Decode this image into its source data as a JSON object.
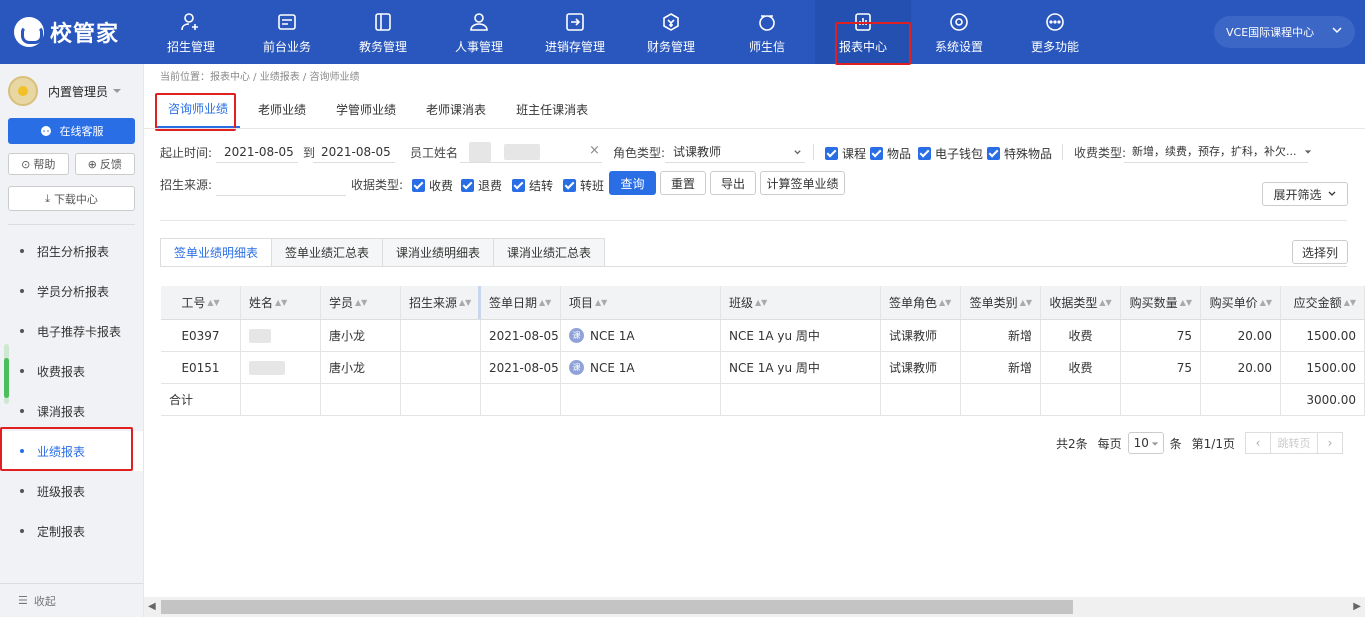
{
  "app": {
    "logo": "校管家",
    "org": "VCE国际课程中心"
  },
  "nav": [
    {
      "label": "招生管理",
      "icon": "user-add-icon"
    },
    {
      "label": "前台业务",
      "icon": "card-icon"
    },
    {
      "label": "教务管理",
      "icon": "book-icon"
    },
    {
      "label": "人事管理",
      "icon": "person-icon"
    },
    {
      "label": "进销存管理",
      "icon": "import-icon"
    },
    {
      "label": "财务管理",
      "icon": "money-icon"
    },
    {
      "label": "师生信",
      "icon": "chat-icon"
    },
    {
      "label": "报表中心",
      "icon": "report-icon"
    },
    {
      "label": "系统设置",
      "icon": "settings-icon"
    },
    {
      "label": "更多功能",
      "icon": "more-icon"
    }
  ],
  "sidebar": {
    "user": "内置管理员",
    "service": "在线客服",
    "help": "帮助",
    "feedback": "反馈",
    "download": "下载中心",
    "items": [
      "招生分析报表",
      "学员分析报表",
      "电子推荐卡报表",
      "收费报表",
      "课消报表",
      "业绩报表",
      "班级报表",
      "定制报表"
    ],
    "collapse": "收起"
  },
  "breadcrumb": "当前位置：报表中心 / 业绩报表 / 咨询师业绩",
  "tabs": [
    "咨询师业绩",
    "老师业绩",
    "学管师业绩",
    "老师课消表",
    "班主任课消表"
  ],
  "filters": {
    "date_label": "起止时间:",
    "date_from": "2021-08-05",
    "to_label": "到",
    "date_to": "2021-08-05",
    "staff_label": "员工姓名",
    "clear": "×",
    "role_label": "角色类型:",
    "role_value": "试课教师",
    "item_checks": [
      "课程",
      "物品",
      "电子钱包",
      "特殊物品"
    ],
    "fee_label": "收费类型:",
    "fee_value": "新增，续费，预存，扩科，补欠...",
    "source_label": "招生来源:",
    "receipt_label": "收据类型:",
    "receipt_checks": [
      "收费",
      "退费",
      "结转",
      "转班"
    ],
    "query": "查询",
    "reset": "重置",
    "export": "导出",
    "calc": "计算签单业绩",
    "expand": "展开筛选"
  },
  "subtabs": [
    "签单业绩明细表",
    "签单业绩汇总表",
    "课消业绩明细表",
    "课消业绩汇总表"
  ],
  "select_cols": "选择列",
  "table": {
    "headers": [
      "工号",
      "姓名",
      "学员",
      "招生来源",
      "签单日期",
      "项目",
      "班级",
      "签单角色",
      "签单类别",
      "收据类型",
      "购买数量",
      "购买单价",
      "应交金额"
    ],
    "rows": [
      {
        "id": "E0397",
        "student": "唐小龙",
        "date": "2021-08-05",
        "project": "NCE 1A",
        "class": "NCE 1A yu 周中",
        "role": "试课教师",
        "category": "新增",
        "receipt": "收费",
        "qty": "75",
        "price": "20.00",
        "amount": "1500.00"
      },
      {
        "id": "E0151",
        "student": "唐小龙",
        "date": "2021-08-05",
        "project": "NCE 1A",
        "class": "NCE 1A yu 周中",
        "role": "试课教师",
        "category": "新增",
        "receipt": "收费",
        "qty": "75",
        "price": "20.00",
        "amount": "1500.00"
      }
    ],
    "total_label": "合计",
    "total_amount": "3000.00"
  },
  "pager": {
    "total": "共2条",
    "per_label": "每页",
    "per_value": "10",
    "unit": "条",
    "page_info": "第1/1页",
    "jump": "跳转页"
  },
  "colors": {
    "topbar": "#2a57bd",
    "accent": "#2a6ee6",
    "highlight": "#e02020"
  }
}
